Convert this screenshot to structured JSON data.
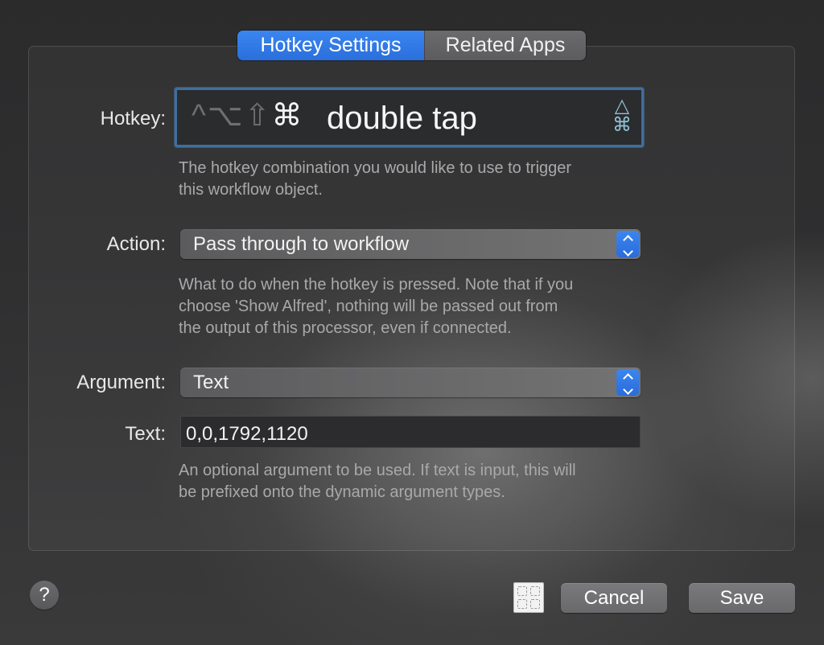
{
  "tabs": {
    "hotkey_settings": "Hotkey Settings",
    "related_apps": "Related Apps"
  },
  "hotkey": {
    "label": "Hotkey:",
    "modifiers": {
      "control": "^",
      "option": "⌥",
      "shift": "⇧",
      "command": "⌘"
    },
    "value": "double tap",
    "side_icons": {
      "top": "△",
      "bottom": "⌘"
    },
    "help": [
      "The hotkey combination you would like to use to trigger",
      "this workflow object."
    ]
  },
  "action": {
    "label": "Action:",
    "selected": "Pass through to workflow",
    "help": [
      "What to do when the hotkey is pressed. Note that if you",
      "choose 'Show Alfred', nothing will be passed out from",
      "the output of this processor, even if connected."
    ]
  },
  "argument": {
    "label": "Argument:",
    "selected": "Text"
  },
  "text": {
    "label": "Text:",
    "value": "0,0,1792,1120",
    "help": [
      "An optional argument to be used. If text is input, this will",
      "be prefixed onto the dynamic argument types."
    ]
  },
  "footer": {
    "help_label": "?",
    "cancel_label": "Cancel",
    "save_label": "Save"
  },
  "colors": {
    "accent": "#2f78e8",
    "hotkey_border": "#3f6f9c"
  }
}
